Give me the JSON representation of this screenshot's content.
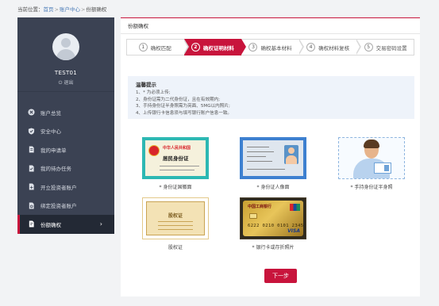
{
  "breadcrumb": {
    "prefix": "当前位置：",
    "items": [
      "首页",
      "账户中心",
      "份额确权"
    ],
    "separator": ">"
  },
  "sidebar": {
    "username": "TEST01",
    "logout_label": "退出",
    "items": [
      {
        "label": "账户总览",
        "icon": "overview-icon"
      },
      {
        "label": "安全中心",
        "icon": "shield-icon"
      },
      {
        "label": "我的申请单",
        "icon": "document-icon"
      },
      {
        "label": "我的待办任务",
        "icon": "task-icon"
      },
      {
        "label": "开立投资者账户",
        "icon": "open-account-icon"
      },
      {
        "label": "绑定投资者账户",
        "icon": "bind-account-icon"
      },
      {
        "label": "份额确权",
        "icon": "confirm-icon",
        "active": true
      }
    ]
  },
  "main": {
    "panel_title": "份额确权",
    "steps": [
      {
        "num": "1",
        "label": "确权匹配"
      },
      {
        "num": "2",
        "label": "确权证明材料",
        "active": true
      },
      {
        "num": "3",
        "label": "确权基本材料"
      },
      {
        "num": "4",
        "label": "确权材料复核"
      },
      {
        "num": "5",
        "label": "交易密码设置"
      }
    ],
    "tips": {
      "title": "温馨提示",
      "lines": [
        "1、* 为必须上传;",
        "2、身份证需为二代身份证，且在有效期内;",
        "3、手持身份证半身照需为亮面、5MG以内照片;",
        "4、上传银行卡信息须与填写银行账户信息一致。"
      ]
    },
    "uploads": [
      {
        "caption": "* 身份证国徽面",
        "card_title": "中华人民共和国",
        "card_subtitle": "居民身份证"
      },
      {
        "caption": "* 身份证人像面"
      },
      {
        "caption": "* 手持身份证半身照"
      },
      {
        "caption": "股权证",
        "card_title": "股权证"
      },
      {
        "caption": "* 银行卡或存折照片",
        "bank": "中国工商银行",
        "card_number": "6222 0210 0101 2345",
        "brand": "VISA"
      }
    ],
    "next_button": "下一步"
  },
  "colors": {
    "accent": "#c8143c",
    "sidebar_bg": "#3b4253",
    "sidebar_active_bg": "#232935",
    "link": "#4a7bb7",
    "tips_bg": "#eef3fa"
  }
}
